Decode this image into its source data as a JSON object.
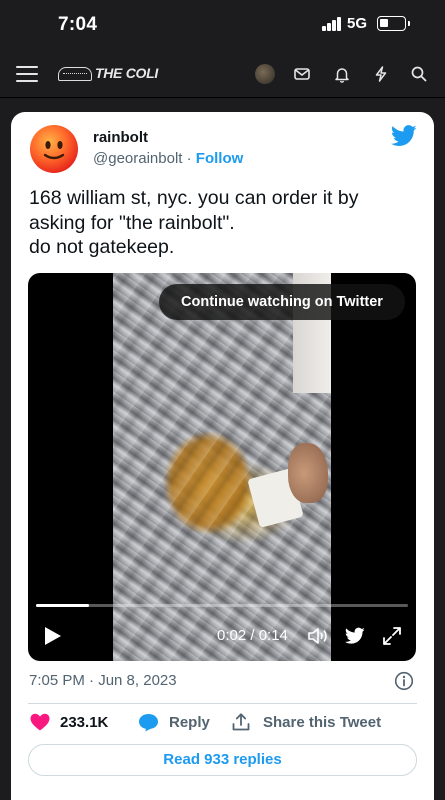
{
  "status_bar": {
    "time": "7:04",
    "network": "5G"
  },
  "site_header": {
    "logo_text": "THE COLI",
    "icons": [
      "menu-icon",
      "user-avatar",
      "mail-icon",
      "bell-icon",
      "lightning-icon",
      "search-icon"
    ]
  },
  "tweet": {
    "author_name": "rainbolt",
    "author_handle": "@georainbolt",
    "separator": "·",
    "follow_label": "Follow",
    "text_lines": [
      "168 william st, nyc. you can order it by",
      "asking for \"the rainbolt\".",
      "do not gatekeep."
    ],
    "video": {
      "continue_label": "Continue watching on Twitter",
      "current_time": "0:02",
      "duration": "0:14",
      "time_display": "0:02 / 0:14",
      "progress_fraction": 0.143
    },
    "timestamp": "7:05 PM · Jun 8, 2023",
    "like_count": "233.1K",
    "reply_label": "Reply",
    "share_label": "Share this Tweet",
    "read_replies_label": "Read 933 replies"
  },
  "colors": {
    "twitter_blue": "#1d9bf0",
    "like_pink": "#f91880",
    "page_dark": "#1c1c1e"
  }
}
